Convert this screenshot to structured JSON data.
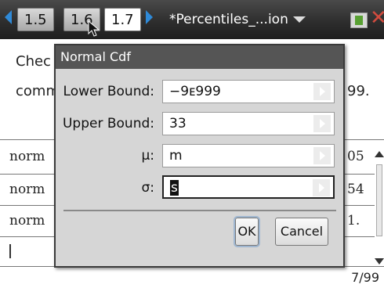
{
  "tabs": [
    "1.5",
    "1.6",
    "1.7"
  ],
  "document_title": "*Percentiles_...ion",
  "notes": {
    "line1_visible": "Chec",
    "line2_visible": "comm",
    "line2_tail": "99."
  },
  "calculator": {
    "rows": [
      {
        "expr": "norm",
        "result": "05"
      },
      {
        "expr": "norm",
        "result": "54"
      },
      {
        "expr": "norm",
        "result": "1."
      }
    ],
    "cursor": "|",
    "page_count": "7/99"
  },
  "dialog": {
    "title": "Normal Cdf",
    "fields": [
      {
        "label": "Lower Bound:",
        "value": "−9ᴇ999"
      },
      {
        "label": "Upper Bound:",
        "value": "33"
      },
      {
        "label": "μ:",
        "value": "m"
      },
      {
        "label": "σ:",
        "value": "s"
      }
    ],
    "ok_label": "OK",
    "cancel_label": "Cancel"
  },
  "colors": {
    "accent_blue": "#2f8ad8",
    "dialog_title_bg": "#555555",
    "battery_green": "#58a032",
    "close_red": "#d14b3e"
  }
}
